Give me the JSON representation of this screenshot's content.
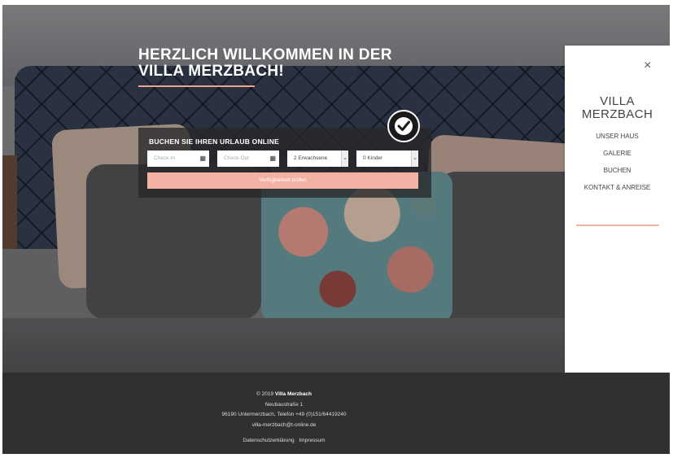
{
  "hero": {
    "title": "HERZLICH WILLKOMMEN IN DER VILLA MERZBACH!"
  },
  "booking": {
    "title": "BUCHEN SIE IHREN URLAUB ONLINE",
    "checkin_placeholder": "Check-In",
    "checkout_placeholder": "Check-Out",
    "adults_value": "2 Erwachsene",
    "children_value": "0 Kinder",
    "submit_label": "Verfügbarkeit prüfen",
    "badge_icon": "checkmark-badge-icon"
  },
  "side_menu": {
    "close_icon": "×",
    "brand": "VILLA MERZBACH",
    "items": [
      {
        "label": "UNSER HAUS"
      },
      {
        "label": "GALERIE"
      },
      {
        "label": "BUCHEN"
      },
      {
        "label": "KONTAKT & ANREISE"
      }
    ]
  },
  "footer": {
    "copyright_prefix": "© 2019",
    "company": "Villa Merzbach",
    "street": "Neubaustraße 1",
    "city_phone": "96190 Untermerzbach, Telefon +49 (0)151/64419240",
    "email": "villa-merzbach@t-online.de",
    "privacy_label": "Datenschutzerklärung",
    "imprint_label": "Impressum"
  },
  "colors": {
    "accent": "#f4b2a5",
    "footer_bg": "#303030"
  }
}
